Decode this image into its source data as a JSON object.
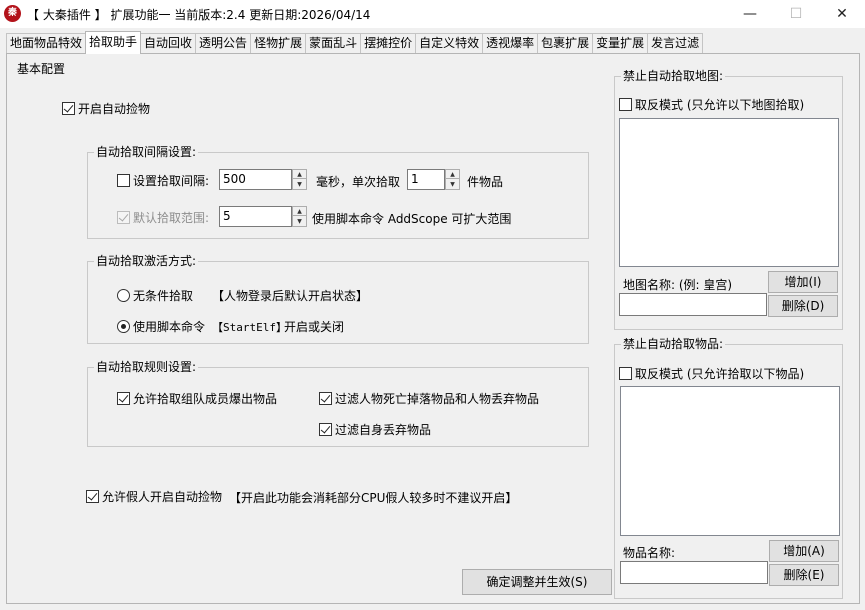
{
  "window": {
    "icon_text": "秦",
    "title": "【 大秦插件 】 扩展功能一 当前版本:2.4 更新日期:2026/04/14",
    "minimize": "—",
    "maximize": "☐",
    "close": "✕"
  },
  "tabs": [
    {
      "label": "地面物品特效"
    },
    {
      "label": "拾取助手"
    },
    {
      "label": "自动回收"
    },
    {
      "label": "透明公告"
    },
    {
      "label": "怪物扩展"
    },
    {
      "label": "蒙面乱斗"
    },
    {
      "label": "摆摊控价"
    },
    {
      "label": "自定义特效"
    },
    {
      "label": "透视爆率"
    },
    {
      "label": "包裹扩展"
    },
    {
      "label": "变量扩展"
    },
    {
      "label": "发言过滤"
    }
  ],
  "basic": {
    "title": "基本配置",
    "auto_pickup_label": "开启自动捡物",
    "auto_pickup_checked": true
  },
  "interval": {
    "title": "自动拾取间隔设置:",
    "set_interval_label": "设置拾取间隔:",
    "set_interval_checked": false,
    "interval_value": "500",
    "interval_unit": "毫秒，单次拾取",
    "count_value": "1",
    "count_unit": "件物品",
    "default_range_label": "默认拾取范围:",
    "default_range_checked": true,
    "range_value": "5",
    "range_hint": "使用脚本命令 AddScope 可扩大范围"
  },
  "activation": {
    "title": "自动拾取激活方式:",
    "unconditional_label": "无条件拾取",
    "unconditional_note": "【人物登录后默认开启状态】",
    "script_label": "使用脚本命令",
    "script_cmd": "【StartElf】",
    "script_note": "开启或关闭",
    "selected": "script"
  },
  "rules": {
    "title": "自动拾取规则设置:",
    "allow_team_label": "允许拾取组队成员爆出物品",
    "filter_death_label": "过滤人物死亡掉落物品和人物丢弃物品",
    "filter_self_label": "过滤自身丢弃物品"
  },
  "fake": {
    "label": "允许假人开启自动捡物",
    "note": "【开启此功能会消耗部分CPU假人较多时不建议开启】"
  },
  "confirm_button": "确定调整并生效(S)",
  "ban_map": {
    "title": "禁止自动拾取地图:",
    "invert_label": "取反模式 (只允许以下地图拾取)",
    "name_label": "地图名称: (例: 皇宫)",
    "add_button": "增加(I)",
    "delete_button": "删除(D)",
    "name_value": ""
  },
  "ban_item": {
    "title": "禁止自动拾取物品:",
    "invert_label": "取反模式 (只允许拾取以下物品)",
    "name_label": "物品名称:",
    "add_button": "增加(A)",
    "delete_button": "删除(E)",
    "name_value": ""
  },
  "icons": {
    "spin_up": "▲",
    "spin_down": "▼"
  }
}
